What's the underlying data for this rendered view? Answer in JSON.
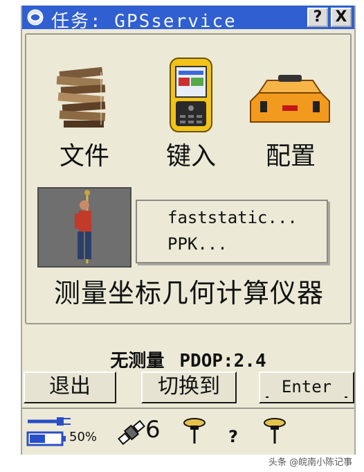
{
  "window": {
    "title": "任务: GPSservice",
    "help_label": "?",
    "close_label": "X"
  },
  "icons": [
    {
      "label": "文件",
      "icon": "books-icon"
    },
    {
      "label": "键入",
      "icon": "handheld-device-icon"
    },
    {
      "label": "配置",
      "icon": "toolbox-icon"
    }
  ],
  "survey_menu": {
    "items": [
      "faststatic...",
      "PPK..."
    ]
  },
  "survey_row_label": "测量坐标几何计算仪器",
  "status": {
    "survey": "无测量",
    "pdop": "PDOP:2.4"
  },
  "buttons": {
    "exit": "退出",
    "switch": "切换到",
    "enter": "Enter"
  },
  "statusbar": {
    "battery_percent": "50%",
    "satellites": "6",
    "unknown": "?"
  },
  "watermark": "头条 @皖南小陈记事"
}
